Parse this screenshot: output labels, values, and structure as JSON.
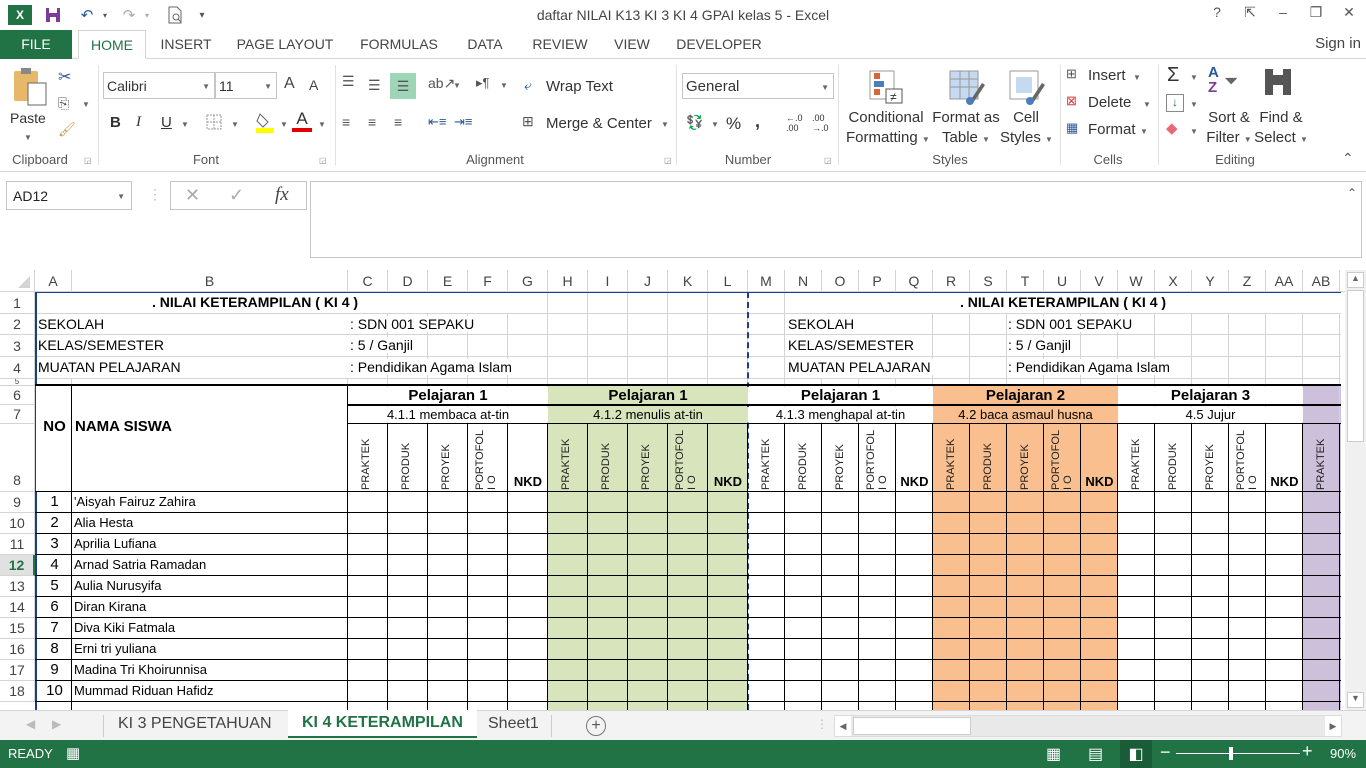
{
  "window": {
    "title": "daftar NILAI K13 KI 3 KI 4 GPAI kelas 5 - Excel",
    "controls": {
      "help": "?",
      "ribbon_display": "⇱",
      "minimize": "‒",
      "restore": "❐",
      "close": "✕"
    }
  },
  "quick_access": {
    "excel_icon": "X",
    "save_icon": "save-icon",
    "undo_icon": "undo-icon",
    "redo_icon": "redo-icon",
    "preview_icon": "print-preview-icon",
    "customize": "▾"
  },
  "ribbon_tabs": [
    {
      "label": "FILE"
    },
    {
      "label": "HOME",
      "active": true
    },
    {
      "label": "INSERT"
    },
    {
      "label": "PAGE LAYOUT"
    },
    {
      "label": "FORMULAS"
    },
    {
      "label": "DATA"
    },
    {
      "label": "REVIEW"
    },
    {
      "label": "VIEW"
    },
    {
      "label": "DEVELOPER"
    }
  ],
  "sign_in": "Sign in",
  "ribbon": {
    "clipboard": {
      "label": "Clipboard",
      "paste": "Paste"
    },
    "font": {
      "label": "Font",
      "font_name": "Calibri",
      "font_size": "11",
      "bold": "B",
      "italic": "I",
      "underline": "U",
      "grow": "A",
      "shrink": "A",
      "font_color": "A",
      "fill_color": "#ffff00",
      "text_color": "#e00000"
    },
    "alignment": {
      "label": "Alignment",
      "wrap_text": "Wrap Text",
      "merge_center": "Merge & Center"
    },
    "number": {
      "label": "Number",
      "format": "General",
      "percent": "%",
      "comma": ",",
      "inc_decimal": "←.0 .00",
      "dec_decimal": ".00 →.0"
    },
    "styles": {
      "label": "Styles",
      "conditional": [
        "Conditional",
        "Formatting"
      ],
      "format_table": [
        "Format as",
        "Table"
      ],
      "cell_styles": [
        "Cell",
        "Styles"
      ]
    },
    "cells": {
      "label": "Cells",
      "insert": "Insert",
      "delete": "Delete",
      "format": "Format"
    },
    "editing": {
      "label": "Editing",
      "autosum": "Σ",
      "sort_filter": [
        "Sort &",
        "Filter"
      ],
      "find_select": [
        "Find &",
        "Select"
      ]
    }
  },
  "formula_bar": {
    "name_box": "AD12",
    "cancel": "✕",
    "enter": "✓",
    "fx": "fx",
    "formula": ""
  },
  "columns": [
    "A",
    "B",
    "C",
    "D",
    "E",
    "F",
    "G",
    "H",
    "I",
    "J",
    "K",
    "L",
    "M",
    "N",
    "O",
    "P",
    "Q",
    "R",
    "S",
    "T",
    "U",
    "V",
    "W",
    "X",
    "Y",
    "Z",
    "AA",
    "AB"
  ],
  "rows": [
    "1",
    "2",
    "3",
    "4",
    "5",
    "6",
    "7",
    "8",
    "9",
    "10",
    "11",
    "12",
    "13",
    "14",
    "15",
    "16",
    "17",
    "18"
  ],
  "active_row": "12",
  "sheet": {
    "title": ". NILAI KETERAMPILAN ( KI 4 )",
    "info": [
      {
        "label": "SEKOLAH",
        "value": ": SDN 001 SEPAKU"
      },
      {
        "label": "KELAS/SEMESTER",
        "value": ": 5 / Ganjil"
      },
      {
        "label": "MUATAN PELAJARAN",
        "value": ": Pendidikan Agama Islam"
      }
    ],
    "header_no": "NO",
    "header_name": "NAMA SISWA",
    "groups": [
      {
        "title": "Pelajaran 1",
        "kd": "4.1.1 membaca at-tin",
        "color": "#ffffff"
      },
      {
        "title": "Pelajaran 1",
        "kd": "4.1.2 menulis at-tin",
        "color": "#d8e4bc"
      },
      {
        "title": "Pelajaran 1",
        "kd": "4.1.3 menghapal at-tin",
        "color": "#ffffff"
      },
      {
        "title": "Pelajaran 2",
        "kd": "4.2 baca asmaul husna",
        "color": "#fabf8f"
      },
      {
        "title": "Pelajaran 3",
        "kd": "4.5  Jujur",
        "color": "#ffffff"
      },
      {
        "title": "",
        "kd": "",
        "color": "#ccc0da"
      }
    ],
    "subheaders": [
      "PRAKTEK",
      "PRODUK",
      "PROYEK",
      "PORTOFOLI O",
      "NKD"
    ],
    "students": [
      {
        "no": "1",
        "name": "'Aisyah Fairuz Zahira"
      },
      {
        "no": "2",
        "name": "Alia Hesta"
      },
      {
        "no": "3",
        "name": "Aprilia Lufiana"
      },
      {
        "no": "4",
        "name": "Arnad Satria Ramadan"
      },
      {
        "no": "5",
        "name": "Aulia Nurusyifa"
      },
      {
        "no": "6",
        "name": "Diran Kirana"
      },
      {
        "no": "7",
        "name": "Diva Kiki Fatmala"
      },
      {
        "no": "8",
        "name": "Erni tri yuliana"
      },
      {
        "no": "9",
        "name": "Madina Tri Khoirunnisa"
      },
      {
        "no": "10",
        "name": "Mummad Riduan Hafidz"
      }
    ]
  },
  "sheet_tabs": [
    {
      "label": "KI 3 PENGETAHUAN"
    },
    {
      "label": "KI 4 KETERAMPILAN",
      "active": true
    },
    {
      "label": "Sheet1"
    }
  ],
  "add_sheet": "+",
  "status": {
    "ready": "READY",
    "zoom": "90%",
    "zoom_level_percent": 90
  }
}
